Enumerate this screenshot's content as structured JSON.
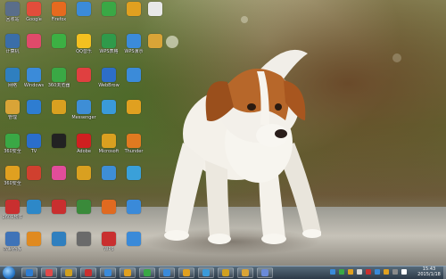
{
  "desktop": {
    "icons": [
      {
        "label": "回收站",
        "icon": "recycle-bin-icon",
        "color": "#5a6e8a"
      },
      {
        "label": "计算机",
        "icon": "computer-icon",
        "color": "#3a6ea8"
      },
      {
        "label": "网络",
        "icon": "network-icon",
        "color": "#2f7fbf"
      },
      {
        "label": "管理",
        "icon": "folder-icon",
        "color": "#d9a437"
      },
      {
        "label": "360安全",
        "icon": "shield-icon",
        "color": "#3aa845"
      },
      {
        "label": "360安全",
        "icon": "security-icon",
        "color": "#e0a020"
      },
      {
        "label": "2601软件",
        "icon": "software-icon",
        "color": "#c92f2f"
      },
      {
        "label": "控制面板",
        "icon": "control-panel-icon",
        "color": "#3f73b8"
      },
      {
        "label": "Google",
        "icon": "chrome-icon",
        "color": "#e24d3b"
      },
      {
        "label": "",
        "icon": "app-icon",
        "color": "#e04a6a"
      },
      {
        "label": "Windows",
        "icon": "windows-icon",
        "color": "#3b8bd9"
      },
      {
        "label": "",
        "icon": "ie-icon",
        "color": "#2e7dd1"
      },
      {
        "label": "TV",
        "icon": "tv-icon",
        "color": "#2a6ecb"
      },
      {
        "label": "",
        "icon": "app-icon",
        "color": "#d0402f"
      },
      {
        "label": "",
        "icon": "app-icon",
        "color": "#2d88c8"
      },
      {
        "label": "",
        "icon": "app-icon",
        "color": "#e08a20"
      },
      {
        "label": "Firefox",
        "icon": "firefox-icon",
        "color": "#e66a1f"
      },
      {
        "label": "",
        "icon": "wechat-icon",
        "color": "#3cb043"
      },
      {
        "label": "360浏览器",
        "icon": "browser-360-icon",
        "color": "#3aa845"
      },
      {
        "label": "",
        "icon": "app-icon",
        "color": "#d9a020"
      },
      {
        "label": "",
        "icon": "qq-icon",
        "color": "#222222"
      },
      {
        "label": "",
        "icon": "app-icon",
        "color": "#e24d9a"
      },
      {
        "label": "",
        "icon": "app-icon",
        "color": "#c92f2f"
      },
      {
        "label": "",
        "icon": "bird-icon",
        "color": "#2f7fbf"
      },
      {
        "label": "",
        "icon": "app-icon",
        "color": "#3b8bd9"
      },
      {
        "label": "QQ音乐",
        "icon": "music-icon",
        "color": "#f3c020"
      },
      {
        "label": "",
        "icon": "browser-icon",
        "color": "#e04040"
      },
      {
        "label": "Messenger",
        "icon": "messenger-icon",
        "color": "#3e8ed6"
      },
      {
        "label": "Adobe",
        "icon": "adobe-icon",
        "color": "#d02020"
      },
      {
        "label": "",
        "icon": "app-icon",
        "color": "#d9a020"
      },
      {
        "label": "",
        "icon": "app-icon",
        "color": "#3a8a3a"
      },
      {
        "label": "",
        "icon": "media-icon",
        "color": "#6a6a6a"
      },
      {
        "label": "",
        "icon": "app-icon",
        "color": "#3aa845"
      },
      {
        "label": "WPS表格",
        "icon": "wps-sheet-icon",
        "color": "#2f9a4a"
      },
      {
        "label": "WebBrow",
        "icon": "web-icon",
        "color": "#2d6ec8"
      },
      {
        "label": "",
        "icon": "app-icon",
        "color": "#3a9ad9"
      },
      {
        "label": "Microsoft",
        "icon": "office-icon",
        "color": "#d9a020"
      },
      {
        "label": "",
        "icon": "app-icon",
        "color": "#3e8ed6"
      },
      {
        "label": "",
        "icon": "app-icon",
        "color": "#e06a20"
      },
      {
        "label": "WPS",
        "icon": "wps-icon",
        "color": "#c92f2f"
      },
      {
        "label": "",
        "icon": "update-icon",
        "color": "#e0a020"
      },
      {
        "label": "WPS演示",
        "icon": "wps-ppt-icon",
        "color": "#3b8bd9"
      },
      {
        "label": "",
        "icon": "pen-icon",
        "color": "#3b8bd9"
      },
      {
        "label": "",
        "icon": "app-icon",
        "color": "#e0a020"
      },
      {
        "label": "Thunder",
        "icon": "thunder-icon",
        "color": "#e07a20"
      },
      {
        "label": "",
        "icon": "app-icon",
        "color": "#3aa0d9"
      },
      {
        "label": "",
        "icon": "app-icon",
        "color": "#3a8ad9"
      },
      {
        "label": "",
        "icon": "play-icon",
        "color": "#3a8ad9"
      },
      {
        "label": "",
        "icon": "file-icon",
        "color": "#e8e8e8"
      },
      {
        "label": "",
        "icon": "folder-icon",
        "color": "#d9a437"
      },
      {
        "label": "",
        "icon": "",
        "color": ""
      },
      {
        "label": "",
        "icon": "",
        "color": ""
      },
      {
        "label": "",
        "icon": "",
        "color": ""
      },
      {
        "label": "",
        "icon": "",
        "color": ""
      },
      {
        "label": "",
        "icon": "",
        "color": ""
      },
      {
        "label": "",
        "icon": "",
        "color": ""
      }
    ]
  },
  "taskbar": {
    "pinned": [
      {
        "icon": "ie-icon",
        "color": "#2e7dd1"
      },
      {
        "icon": "app-icon",
        "color": "#e04a4a"
      },
      {
        "icon": "app-icon",
        "color": "#d0a020"
      },
      {
        "icon": "app-icon",
        "color": "#c92f2f"
      },
      {
        "icon": "app-icon",
        "color": "#3a8ad9"
      },
      {
        "icon": "app-icon",
        "color": "#e0a020"
      },
      {
        "icon": "app-icon",
        "color": "#3aa845"
      },
      {
        "icon": "app-icon",
        "color": "#3a8ad9"
      },
      {
        "icon": "app-icon",
        "color": "#e0a020"
      },
      {
        "icon": "app-icon",
        "color": "#3a9ad9"
      },
      {
        "icon": "app-icon",
        "color": "#d0a020"
      },
      {
        "icon": "folder-icon",
        "color": "#d9a437"
      },
      {
        "icon": "app-icon",
        "color": "#6a8ad9"
      }
    ],
    "clock": {
      "time": "15:43",
      "date": "2015/1/18"
    },
    "tray": [
      "#3a8ad9",
      "#3aa845",
      "#e0a020",
      "#d9d9d9",
      "#c92f2f",
      "#3a8ad9",
      "#e0a020",
      "#8a8a8a",
      "#ffffff"
    ]
  }
}
